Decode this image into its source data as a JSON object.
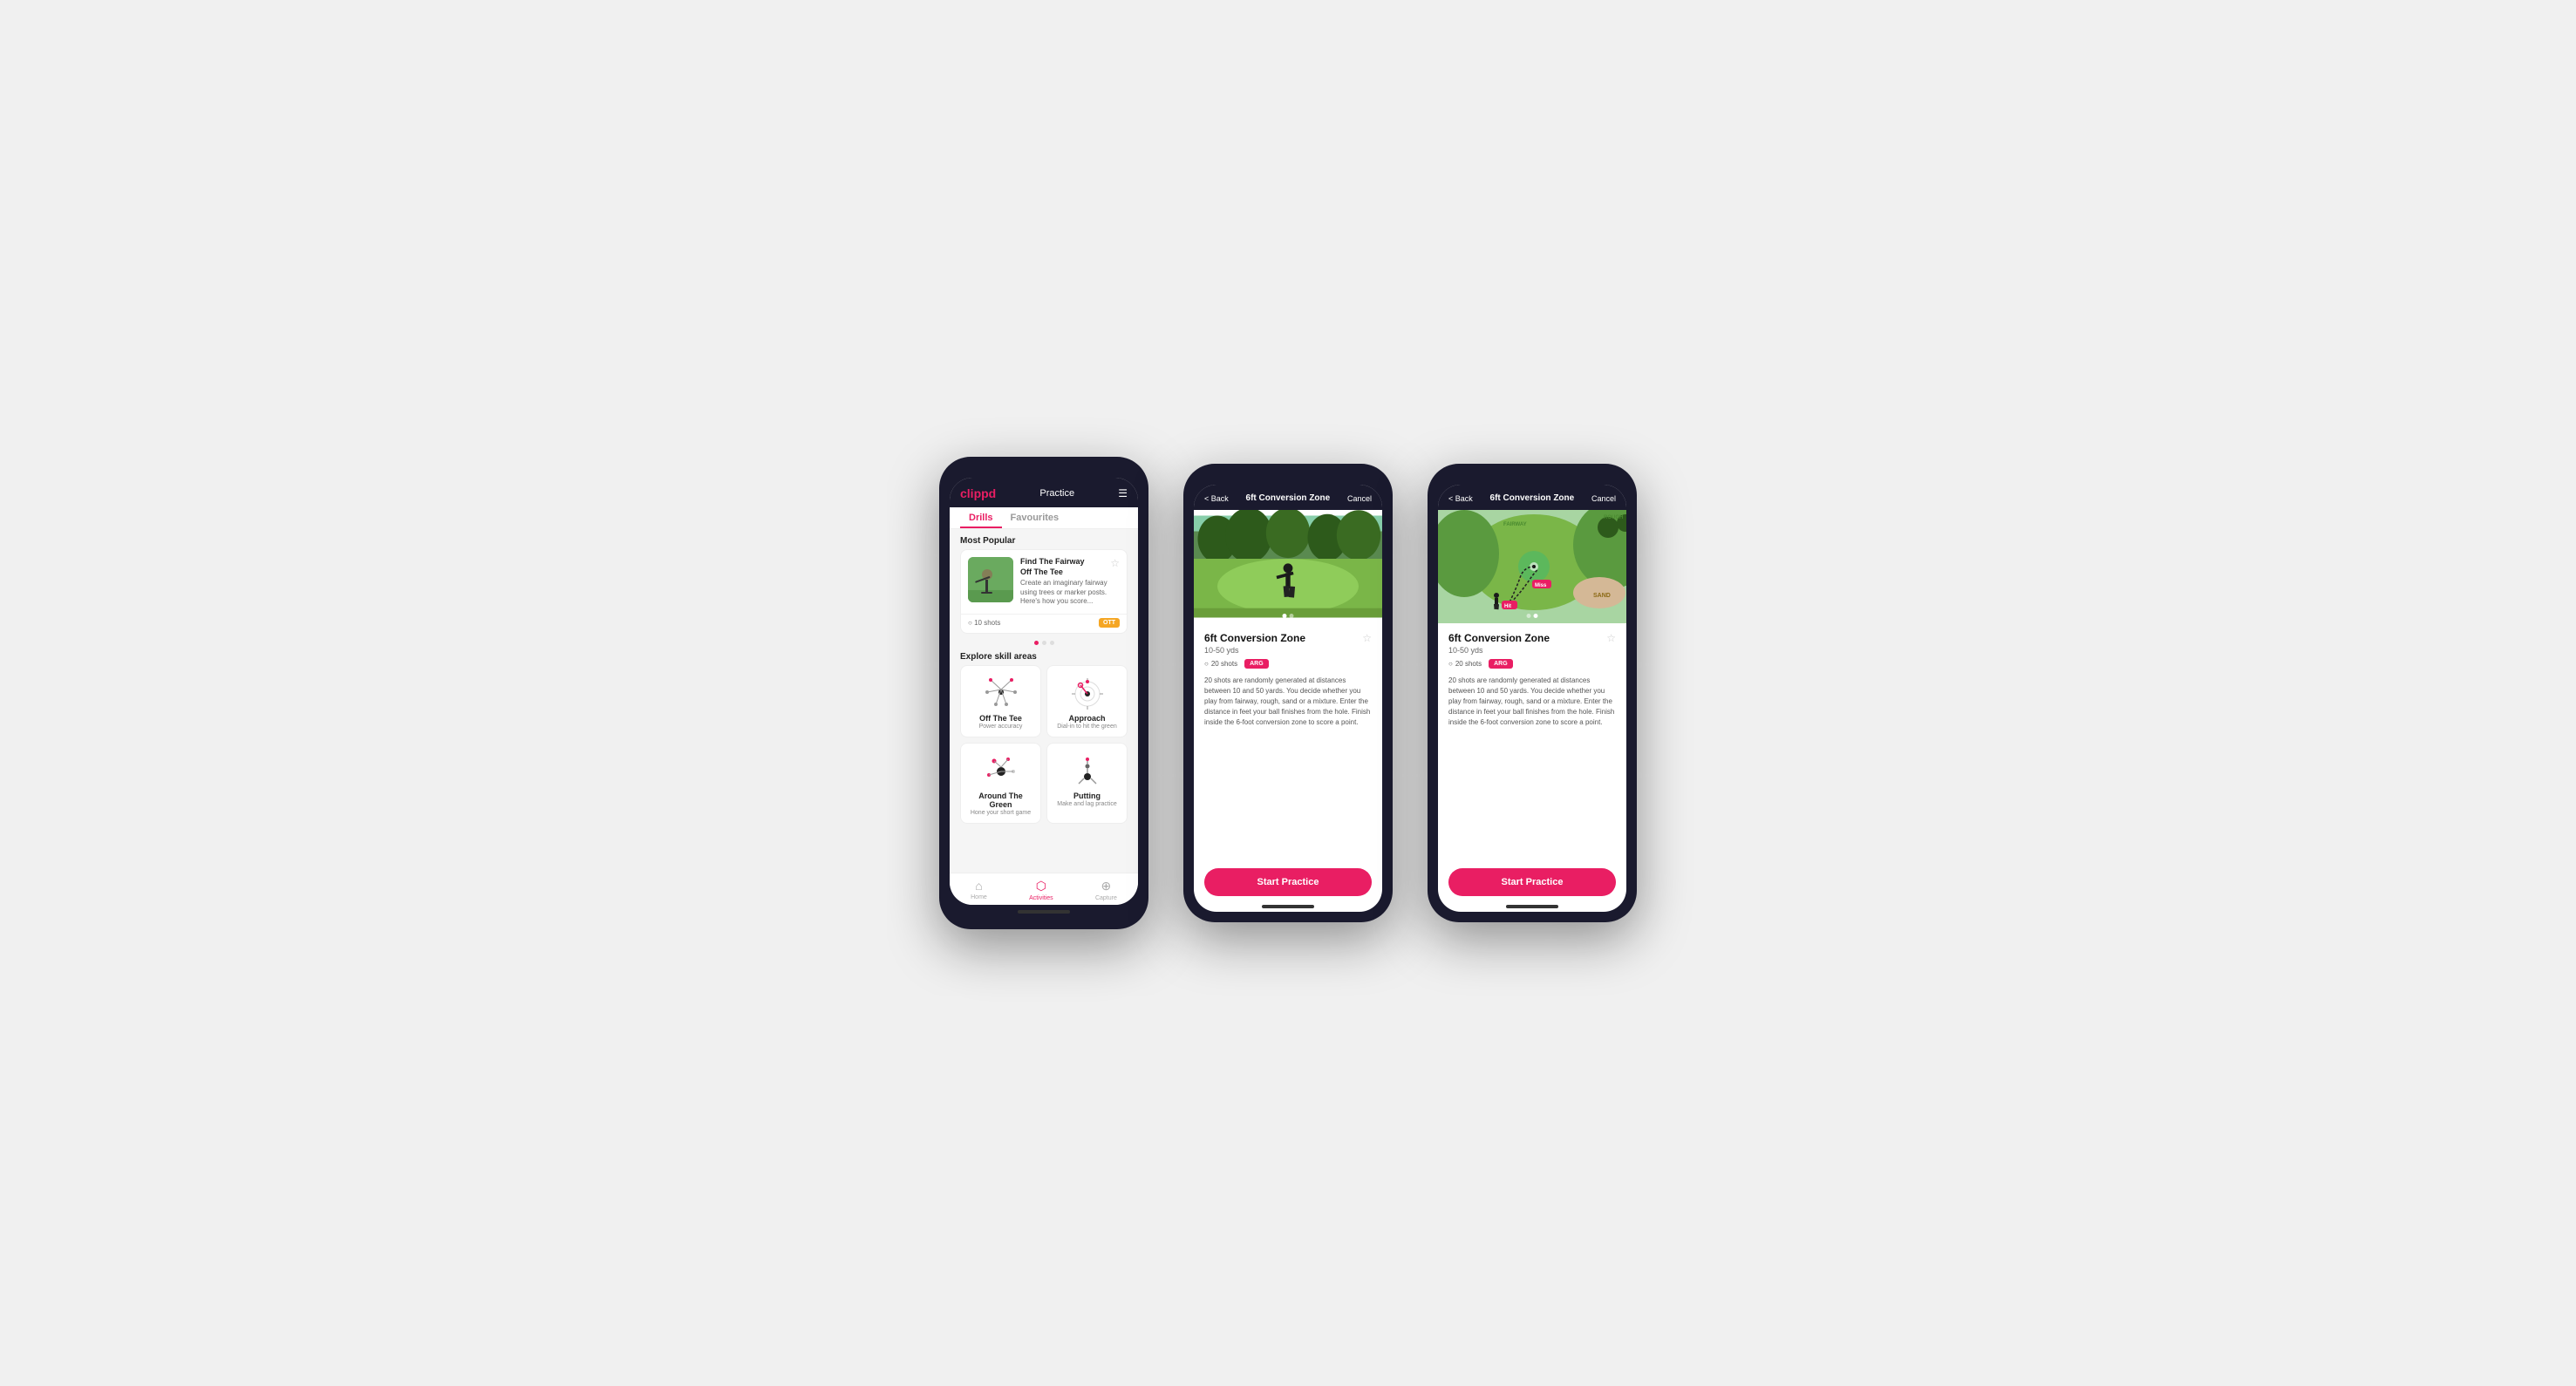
{
  "phones": [
    {
      "id": "phone1",
      "type": "practice-list",
      "header": {
        "logo": "clippd",
        "title": "Practice",
        "menu_icon": "☰"
      },
      "tabs": [
        "Drills",
        "Favourites"
      ],
      "active_tab": 0,
      "most_popular": {
        "section_title": "Most Popular",
        "card": {
          "title": "Find The Fairway",
          "subtitle": "Off The Tee",
          "description": "Create an imaginary fairway using trees or marker posts. Here's how you score...",
          "shots": "10 shots",
          "badge": "OTT"
        },
        "dots": [
          true,
          false,
          false
        ]
      },
      "explore": {
        "section_title": "Explore skill areas",
        "skills": [
          {
            "name": "Off The Tee",
            "desc": "Power accuracy",
            "type": "ott"
          },
          {
            "name": "Approach",
            "desc": "Dial-in to hit the green",
            "type": "approach"
          },
          {
            "name": "Around The Green",
            "desc": "Hone your short game",
            "type": "atg"
          },
          {
            "name": "Putting",
            "desc": "Make and lag practice",
            "type": "putting"
          }
        ]
      },
      "bottom_nav": [
        {
          "label": "Home",
          "icon": "⌂",
          "active": false
        },
        {
          "label": "Activities",
          "icon": "♦",
          "active": true
        },
        {
          "label": "Capture",
          "icon": "⊕",
          "active": false
        }
      ]
    },
    {
      "id": "phone2",
      "type": "drill-detail",
      "header": {
        "back": "< Back",
        "title": "6ft Conversion Zone",
        "cancel": "Cancel"
      },
      "image_type": "photo",
      "dots": [
        true,
        false
      ],
      "drill": {
        "name": "6ft Conversion Zone",
        "range": "10-50 yds",
        "shots": "20 shots",
        "badge": "ARG",
        "description": "20 shots are randomly generated at distances between 10 and 50 yards. You decide whether you play from fairway, rough, sand or a mixture. Enter the distance in feet your ball finishes from the hole. Finish inside the 6-foot conversion zone to score a point."
      },
      "start_btn": "Start Practice"
    },
    {
      "id": "phone3",
      "type": "drill-detail",
      "header": {
        "back": "< Back",
        "title": "6ft Conversion Zone",
        "cancel": "Cancel"
      },
      "image_type": "map",
      "dots": [
        false,
        true
      ],
      "drill": {
        "name": "6ft Conversion Zone",
        "range": "10-50 yds",
        "shots": "20 shots",
        "badge": "ARG",
        "description": "20 shots are randomly generated at distances between 10 and 50 yards. You decide whether you play from fairway, rough, sand or a mixture. Enter the distance in feet your ball finishes from the hole. Finish inside the 6-foot conversion zone to score a point."
      },
      "start_btn": "Start Practice"
    }
  ]
}
